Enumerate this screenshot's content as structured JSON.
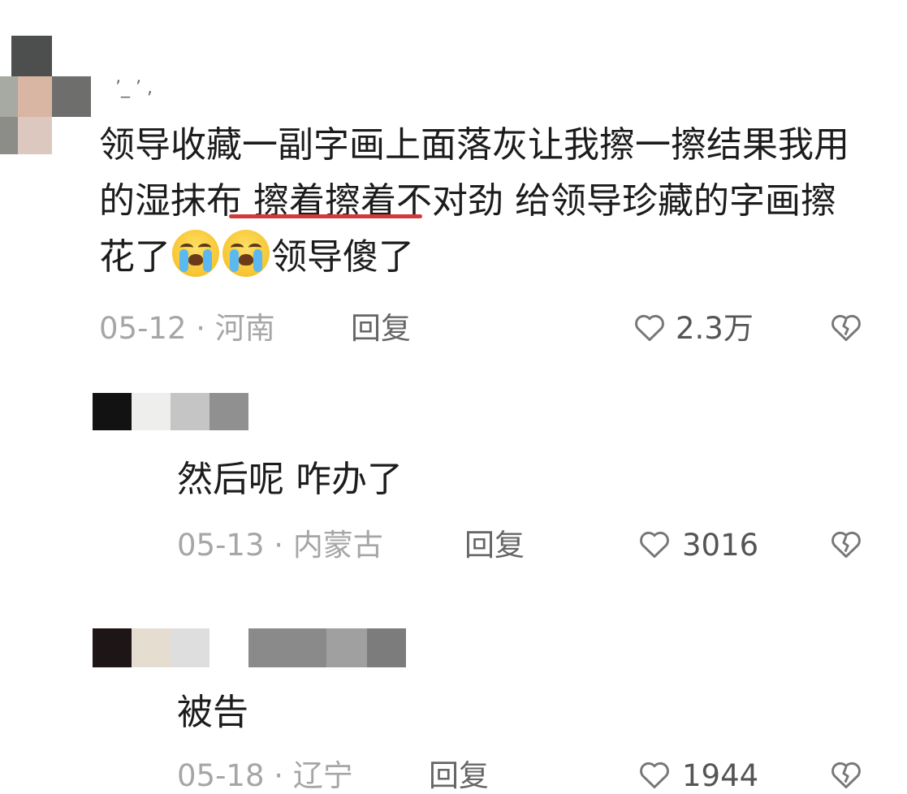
{
  "comments": [
    {
      "username": "’_ ’ ,",
      "text_parts": [
        "领导收藏一副字画上面落灰让我擦一擦结果我用的",
        "湿抹布",
        " 擦着擦着不对劲 给领导珍藏的字画擦花了",
        "领导傻了"
      ],
      "emojis": [
        "crying-face",
        "crying-face"
      ],
      "date": "05-12",
      "location": "河南",
      "reply_label": "回复",
      "likes": "2.3万"
    }
  ],
  "replies": [
    {
      "text": "然后呢  咋办了",
      "date": "05-13",
      "location": "内蒙古",
      "reply_label": "回复",
      "likes": "3016"
    },
    {
      "text": "被告",
      "date": "05-18",
      "location": "辽宁",
      "reply_label": "回复",
      "likes": "1944"
    }
  ],
  "separator": "·",
  "colors": {
    "text": "#1c1c1c",
    "meta": "#a6a6a6",
    "underline": "#d23a3a"
  },
  "icons": [
    "heart-outline-icon",
    "broken-heart-icon"
  ]
}
